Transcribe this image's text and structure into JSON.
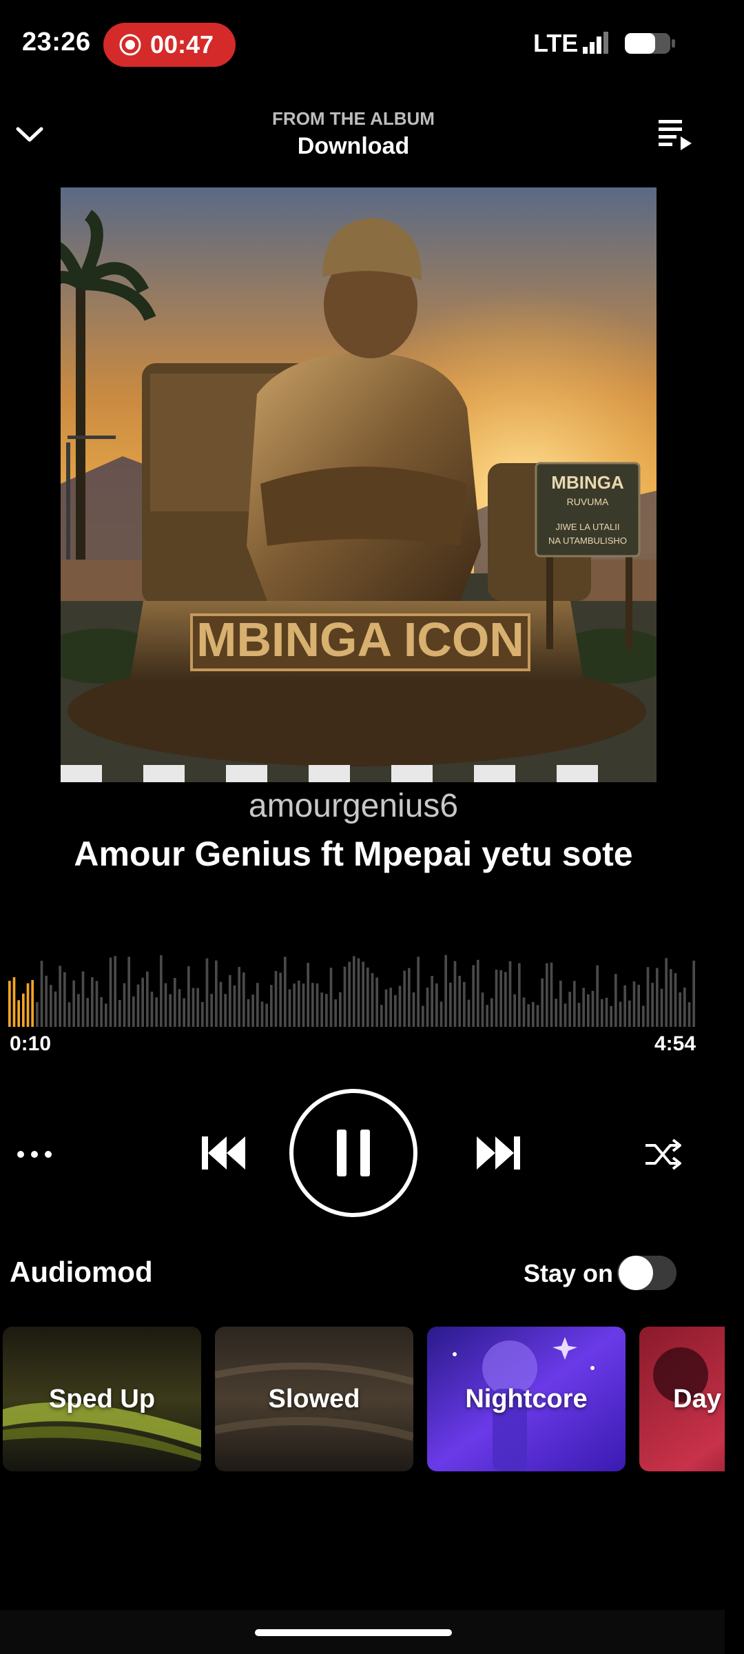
{
  "status_bar": {
    "time": "23:26",
    "recording_time": "00:47",
    "network": "LTE"
  },
  "header": {
    "subtitle": "FROM THE ALBUM",
    "album": "Download"
  },
  "album_art": {
    "statue_text": "MBINGA ICON",
    "sign_line1": "MBINGA",
    "sign_line2": "RUVUMA",
    "sign_line3": "JIWE LA UTALII",
    "sign_line4": "NA UTAMBULISHO"
  },
  "track": {
    "artist": "amourgenius6",
    "title": "Amour Genius ft Mpepai yetu sote"
  },
  "playback": {
    "current_time": "0:10",
    "duration": "4:54",
    "progress_fraction": 0.034,
    "state": "playing"
  },
  "audiomod": {
    "title": "Audiomod",
    "stay_on_label": "Stay on",
    "stay_on_enabled": false,
    "presets": [
      "Sped Up",
      "Slowed",
      "Nightcore",
      "Day"
    ]
  },
  "colors": {
    "accent": "#f5a623",
    "record_pill": "#d42a2a",
    "background": "#000000"
  }
}
